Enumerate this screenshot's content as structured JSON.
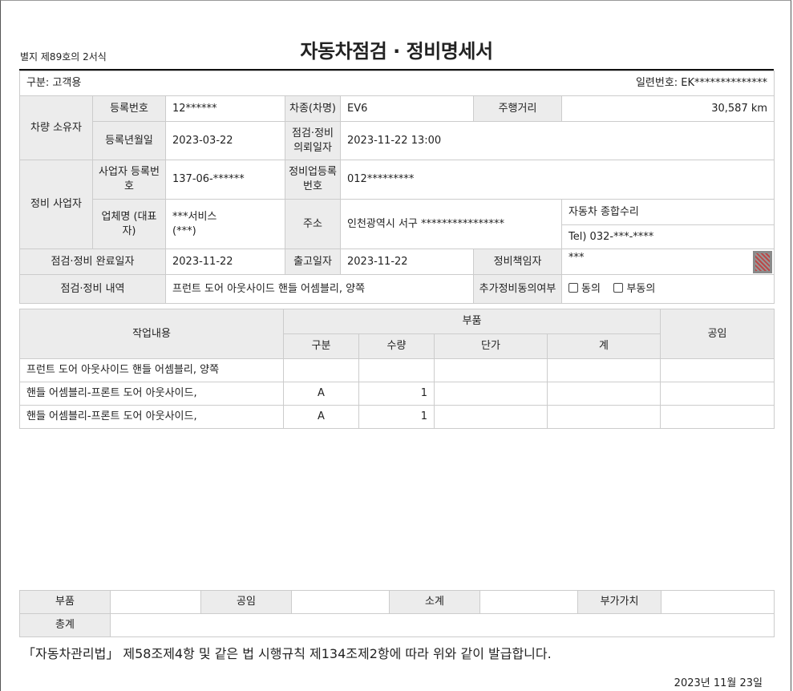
{
  "form_label": "별지 제89호의 2서식",
  "title": "자동차점검 · 정비명세서",
  "category": "구분: 고객용",
  "serial": "일련번호: EK**************",
  "labels": {
    "owner": "차량 소유자",
    "reg_no": "등록번호",
    "model": "차종(차명)",
    "mileage": "주행거리",
    "reg_date": "등록년월일",
    "request_date": "점검·정비 의뢰일자",
    "shop": "정비 사업자",
    "biz_no": "사업자 등록번호",
    "shop_reg_no": "정비업등록 번호",
    "company": "업체명 (대표자)",
    "address": "주소",
    "complete_date": "점검·정비 완료일자",
    "release_date": "출고일자",
    "manager": "정비책임자",
    "details": "점검·정비 내역",
    "consent": "추가정비동의여부"
  },
  "values": {
    "reg_no": "12******",
    "model": "EV6",
    "mileage": "30,587 km",
    "reg_date": "2023-03-22",
    "request_date": "2023-11-22 13:00",
    "biz_no": "137-06-******",
    "shop_reg_no": "012*********",
    "company": "***서비스",
    "rep": "(***)",
    "address": "인천광역시 서구 ****************",
    "shop_type": "자동차 종합수리",
    "tel": "Tel) 032-***-****",
    "complete_date": "2023-11-22",
    "release_date": "2023-11-22",
    "manager": "***",
    "details": "프런트 도어 아웃사이드 핸들 어셈블리, 양쪽",
    "agree": "동의",
    "disagree": "부동의"
  },
  "work_table": {
    "headers": {
      "work": "작업내용",
      "parts": "부품",
      "type": "구분",
      "qty": "수량",
      "unit_price": "단가",
      "total": "계",
      "labor": "공임"
    },
    "rows": [
      {
        "work": "프런트 도어 아웃사이드 핸들 어셈블리, 양쪽",
        "type": "",
        "qty": "",
        "unit_price": "",
        "total": "",
        "labor": ""
      },
      {
        "work": "핸들 어셈블리-프론트 도어 아웃사이드,",
        "type": "A",
        "qty": "1",
        "unit_price": "",
        "total": "",
        "labor": ""
      },
      {
        "work": "핸들 어셈블리-프론트 도어 아웃사이드,",
        "type": "A",
        "qty": "1",
        "unit_price": "",
        "total": "",
        "labor": ""
      }
    ]
  },
  "summary": {
    "parts": "부품",
    "labor": "공임",
    "subtotal": "소계",
    "vat": "부가가치",
    "total": "총계"
  },
  "legal_text": "「자동차관리법」 제58조제4항 및 같은 법 시행규칙 제134조제2항에 따라 위와 같이 발급합니다.",
  "issue_date": "2023년 11월 23일"
}
